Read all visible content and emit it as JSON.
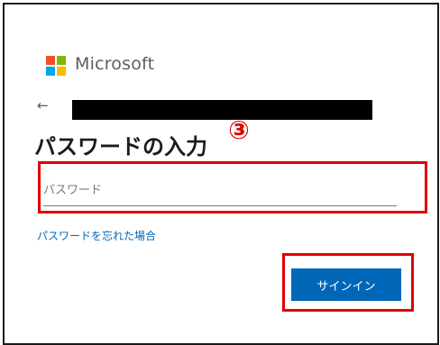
{
  "branding": {
    "logo_icon": "microsoft-logo-icon",
    "logo_colors": {
      "top_left": "#f25022",
      "top_right": "#7fba00",
      "bottom_left": "#00a4ef",
      "bottom_right": "#ffb900"
    },
    "name": "Microsoft"
  },
  "identity": {
    "back_icon": "arrow-left-icon",
    "back_glyph": "←",
    "account_redacted": true
  },
  "title": "パスワードの入力",
  "step_marker": "③",
  "password_field": {
    "placeholder": "パスワード",
    "value": ""
  },
  "forgot_password_link": "パスワードを忘れた場合",
  "signin_button": "サインイン",
  "colors": {
    "accent": "#0067b8",
    "highlight": "#e00000"
  }
}
